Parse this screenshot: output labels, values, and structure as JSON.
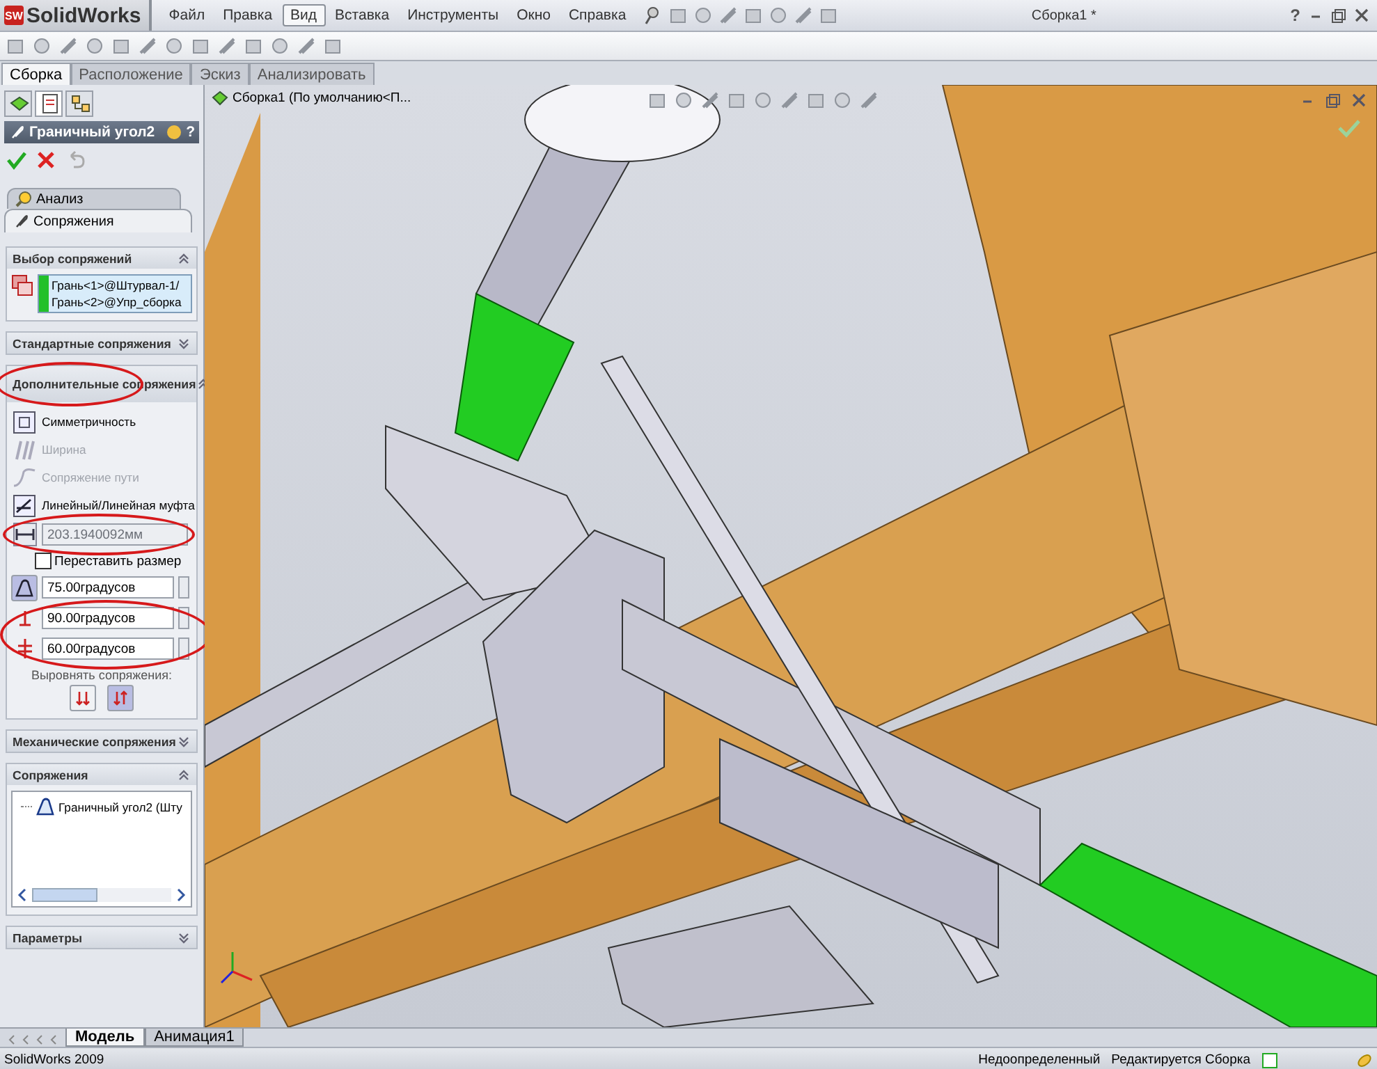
{
  "app": {
    "logo_mark": "SW",
    "logo": "SolidWorks",
    "menu": [
      {
        "label": "Файл",
        "selected": false
      },
      {
        "label": "Правка",
        "selected": false
      },
      {
        "label": "Вид",
        "selected": true
      },
      {
        "label": "Вставка",
        "selected": false
      },
      {
        "label": "Инструменты",
        "selected": false
      },
      {
        "label": "Окно",
        "selected": false
      },
      {
        "label": "Справка",
        "selected": false
      }
    ],
    "document_title": "Сборка1 *",
    "help": "?"
  },
  "command_tabs": [
    {
      "label": "Сборка",
      "selected": true
    },
    {
      "label": "Расположение",
      "selected": false
    },
    {
      "label": "Эскиз",
      "selected": false
    },
    {
      "label": "Анализировать",
      "selected": false
    }
  ],
  "property_manager": {
    "panel_tabs": [
      {
        "selected": false
      },
      {
        "selected": true
      },
      {
        "selected": false
      }
    ],
    "title": "Граничный угол2",
    "help": "?",
    "subtabs": [
      {
        "label": "Анализ",
        "selected": false
      },
      {
        "label": "Сопряжения",
        "selected": true
      }
    ],
    "groups": [
      {
        "kind": "selection",
        "title": "Выбор сопряжений",
        "expanded": true,
        "items": [
          "Грань<1>@Штурвал-1/",
          "Грань<2>@Упр_сборка"
        ]
      },
      {
        "kind": "plain",
        "title": "Стандартные сопряжения",
        "expanded": false
      },
      {
        "kind": "advanced",
        "title": "Дополнительные сопряжения",
        "expanded": true,
        "mate_types": [
          {
            "label": "Симметричность",
            "disabled": false
          },
          {
            "label": "Ширина",
            "disabled": true
          },
          {
            "label": "Сопряжение пути",
            "disabled": true
          },
          {
            "label": "Линейный/Линейная муфта",
            "disabled": false
          }
        ],
        "distance": {
          "value": "203.1940092мм",
          "disabled": true
        },
        "flip_dimension": {
          "label": "Переставить размер",
          "checked": false
        },
        "angle": {
          "value": "75.00градусов",
          "selected": true
        },
        "max_angle": {
          "value": "90.00градусов"
        },
        "min_angle": {
          "value": "60.00градусов"
        },
        "alignment": {
          "label": "Выровнять сопряжения:",
          "options": [
            {
              "selected": false
            },
            {
              "selected": true
            }
          ]
        }
      },
      {
        "kind": "plain",
        "title": "Механические сопряжения",
        "expanded": false
      },
      {
        "kind": "mates",
        "title": "Сопряжения",
        "expanded": true,
        "items": [
          "Граничный угол2 (Шту"
        ]
      },
      {
        "kind": "plain",
        "title": "Параметры",
        "expanded": false
      }
    ]
  },
  "viewport": {
    "tree_root": "Сборка1  (По умолчанию<П..."
  },
  "bottom_tabs": [
    {
      "label": "Модель",
      "selected": true
    },
    {
      "label": "Анимация1",
      "selected": false
    }
  ],
  "status_bar": {
    "app": "SolidWorks 2009",
    "state": "Недоопределенный",
    "mode": "Редактируется Сборка"
  }
}
